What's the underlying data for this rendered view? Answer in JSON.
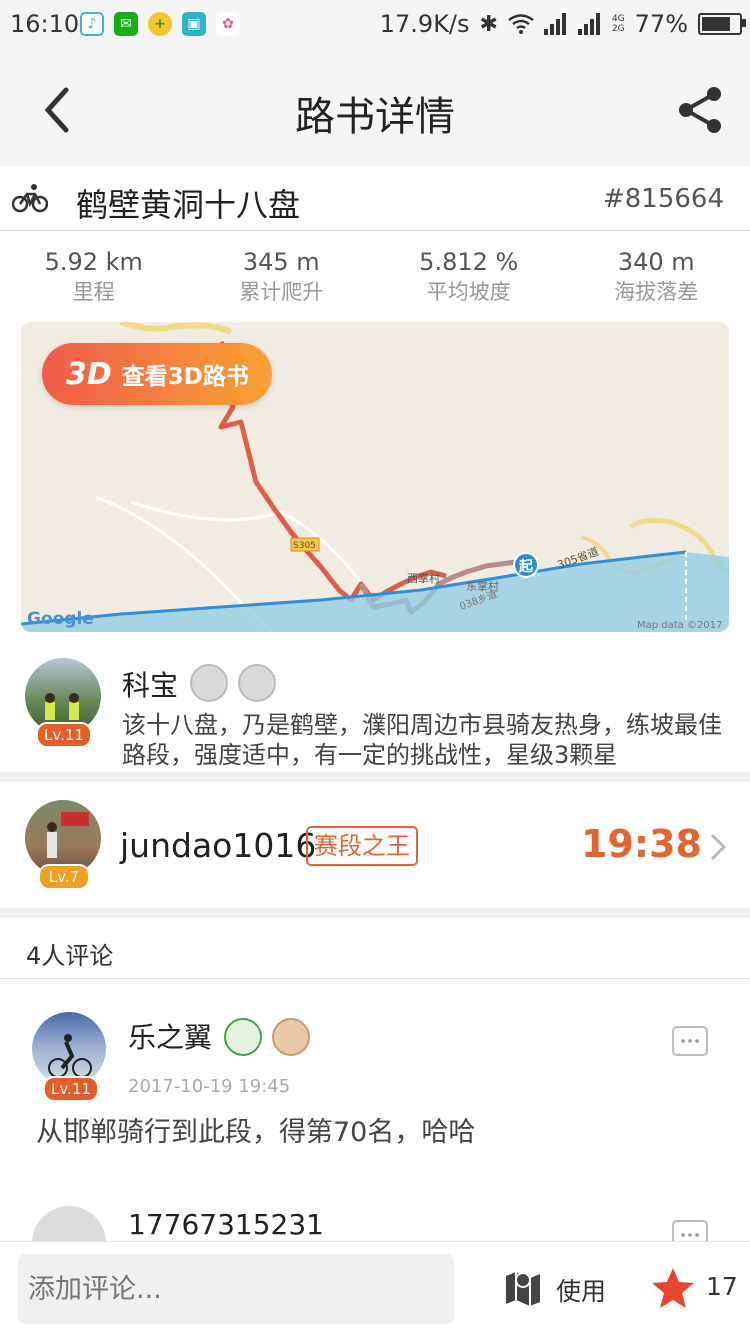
{
  "status_bar": {
    "time": "16:10",
    "network_speed": "17.9K/s",
    "network_types": [
      "4G",
      "2G"
    ],
    "battery": "77%",
    "battery_level": 0.77
  },
  "nav": {
    "title": "路书详情"
  },
  "route": {
    "name": "鹤壁黄洞十八盘",
    "id": "#815664",
    "stats": [
      {
        "value": "5.92 km",
        "label": "里程"
      },
      {
        "value": "345 m",
        "label": "累计爬升"
      },
      {
        "value": "5.812 %",
        "label": "平均坡度"
      },
      {
        "value": "340 m",
        "label": "海拔落差"
      }
    ]
  },
  "map": {
    "button_icon_text": "3D",
    "button_text": "查看3D路书",
    "road_label_1": "S305",
    "road_label_2": "305省道",
    "road_label_3": "038乡道",
    "village_1": "西掌村",
    "village_2": "东掌村",
    "start_marker": "起",
    "google": "Google",
    "copyright": "Map data ©2017",
    "colors": {
      "route": "#e25c4a",
      "elevation": "#2e8fd6"
    }
  },
  "author": {
    "name": "科宝",
    "level": "Lv.11",
    "description": "该十八盘，乃是鹤壁，濮阳周边市县骑友热身，练坡最佳路段，强度适中，有一定的挑战性，星级3颗星"
  },
  "segment_king": {
    "name": "jundao1016",
    "badge": "赛段之王",
    "level": "Lv.7",
    "time": "19:38",
    "accent": "#e2652f"
  },
  "comments": {
    "count_label": "4人评论",
    "items": [
      {
        "name": "乐之翼",
        "level": "Lv.11",
        "time": "2017-10-19 19:45",
        "text": "从邯郸骑行到此段，得第70名，哈哈"
      },
      {
        "name": "17767315231"
      }
    ]
  },
  "bottom_bar": {
    "input_placeholder": "添加评论...",
    "use_label": "使用",
    "favorite_count": "17"
  }
}
